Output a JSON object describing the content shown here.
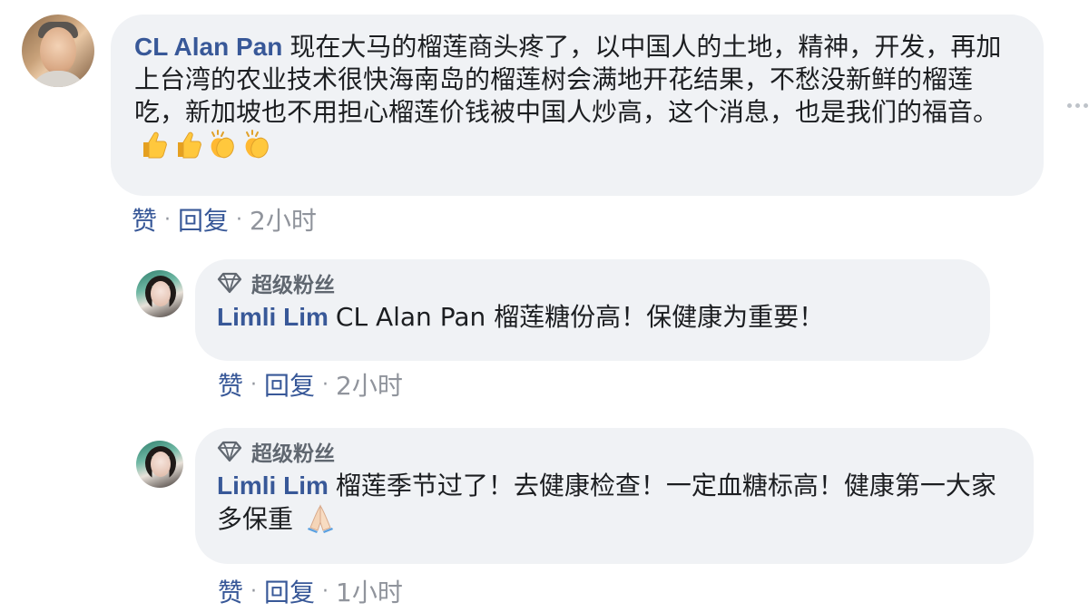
{
  "comments": [
    {
      "author": "CL Alan Pan",
      "text": "现在大马的榴莲商头疼了，以中国人的土地，精神，开发，再加上台湾的农业技术很快海南岛的榴莲树会满地开花结果，不愁没新鲜的榴莲吃，新加坡也不用担心榴莲价钱被中国人炒高，这个消息，也是我们的福音。",
      "emojis": [
        "thumbs-up",
        "thumbs-up",
        "clapping-hands",
        "clapping-hands"
      ],
      "actions": {
        "like": "赞",
        "reply": "回复",
        "time": "2小时"
      }
    },
    {
      "badge": "超级粉丝",
      "author": "Limli Lim",
      "text": "CL Alan Pan 榴莲糖份高！保健康为重要！",
      "actions": {
        "like": "赞",
        "reply": "回复",
        "time": "2小时"
      }
    },
    {
      "badge": "超级粉丝",
      "author": "Limli Lim",
      "text": "榴莲季节过了！去健康检查！一定血糖标高！健康第一大家多保重",
      "emojis": [
        "folded-hands"
      ],
      "actions": {
        "like": "赞",
        "reply": "回复",
        "time": "1小时"
      }
    }
  ],
  "separator": "·",
  "colors": {
    "author": "#385898",
    "bubble": "#f0f2f5",
    "meta": "#90949c",
    "text": "#1c1e21"
  }
}
